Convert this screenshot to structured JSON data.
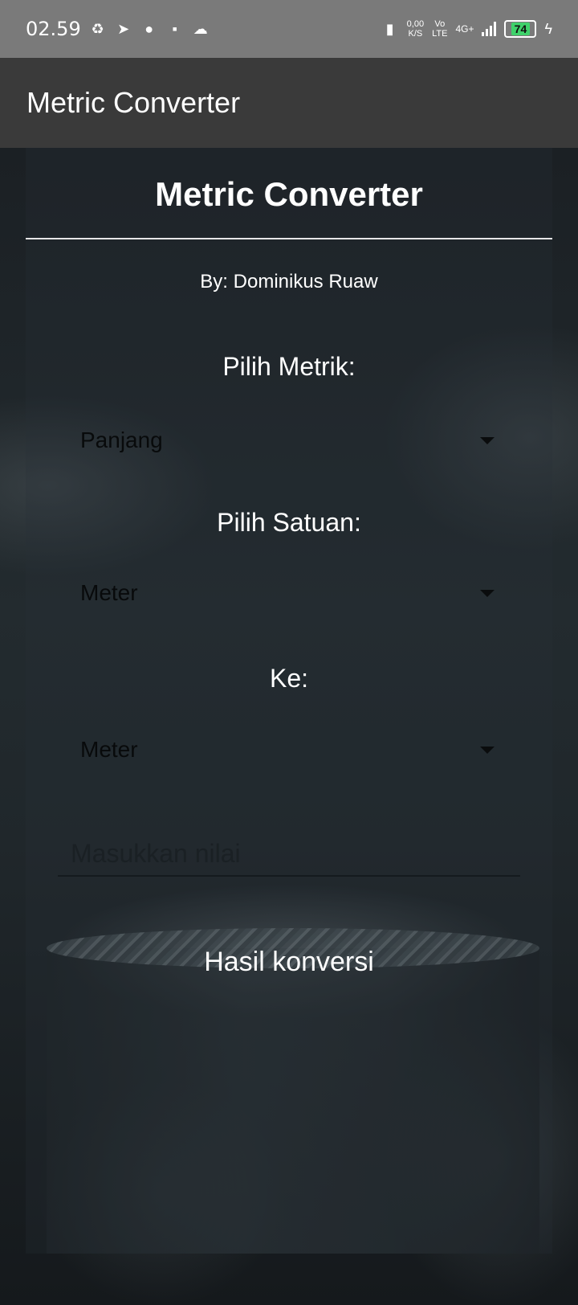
{
  "status_bar": {
    "time": "02.59",
    "net_speed_value": "0,00",
    "net_speed_unit": "K/S",
    "volte_top": "Vo",
    "volte_bottom": "LTE",
    "network": "4G+",
    "battery": "74"
  },
  "app_bar": {
    "title": "Metric Converter"
  },
  "main": {
    "heading": "Metric Converter",
    "author": "By: Dominikus Ruaw",
    "metric_label": "Pilih Metrik:",
    "metric_value": "Panjang",
    "unit_label": "Pilih Satuan:",
    "unit_value": "Meter",
    "to_label": "Ke:",
    "to_value": "Meter",
    "input_placeholder": "Masukkan nilai",
    "result_text": "Hasil konversi"
  }
}
